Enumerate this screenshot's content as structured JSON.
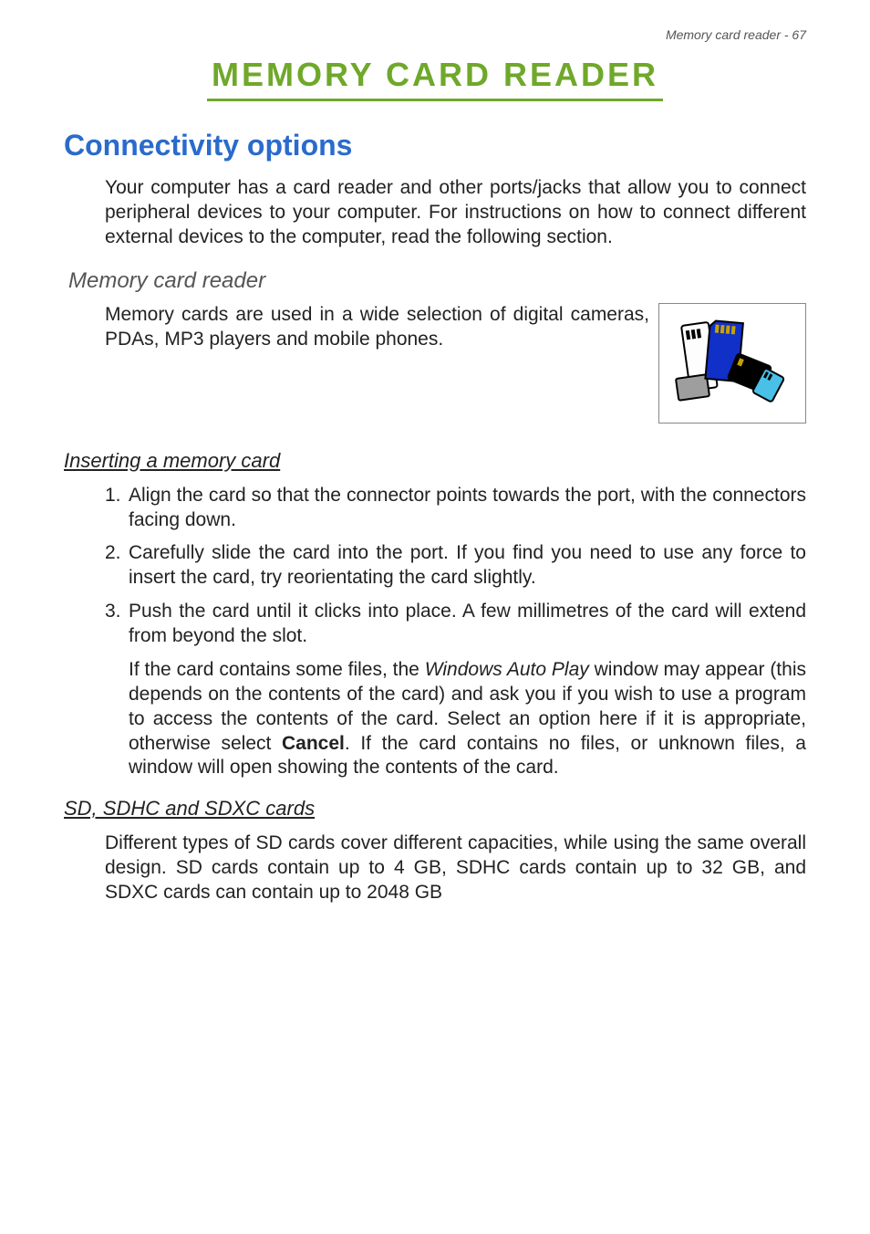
{
  "header": {
    "running": "Memory card reader - 67"
  },
  "title": "MEMORY CARD READER",
  "h2": "Connectivity options",
  "intro": "Your computer has a card reader and other ports/jacks that allow you to connect peripheral devices to your computer. For instructions on how to connect different external devices to the computer, read the following section.",
  "h3": "Memory card reader",
  "mc_intro": "Memory cards are used in a wide selection of digital cameras, PDAs, MP3 players and mobile phones.",
  "h4a": "Inserting a memory card",
  "list": {
    "n1": "1.",
    "i1": "Align the card so that the connector points towards the port, with the connectors facing down.",
    "n2": "2.",
    "i2": "Carefully slide the card into the port. If you find you need to use any force to insert the card, try reorientating the card slightly.",
    "n3": "3.",
    "i3": "Push the card until it clicks into place. A few millimetres of the card will extend from beyond the slot."
  },
  "sub": {
    "p1a": "If the card contains some files, the ",
    "p1em": "Windows Auto Play",
    "p1b": " window may appear (this depends on the contents of the card) and ask you if you wish to use a program to access the contents of the card. Select an option here if it is appropriate, otherwise select ",
    "p1strong": "Cancel",
    "p1c": ". If the card contains no files, or unknown files, a window will open showing the contents of the card."
  },
  "h4b": "SD, SDHC and SDXC cards",
  "sd_para": "Different types of SD cards cover different capacities, while using the same overall design. SD cards contain up to 4 GB, SDHC cards contain up to 32 GB, and SDXC cards can contain up to 2048 GB"
}
